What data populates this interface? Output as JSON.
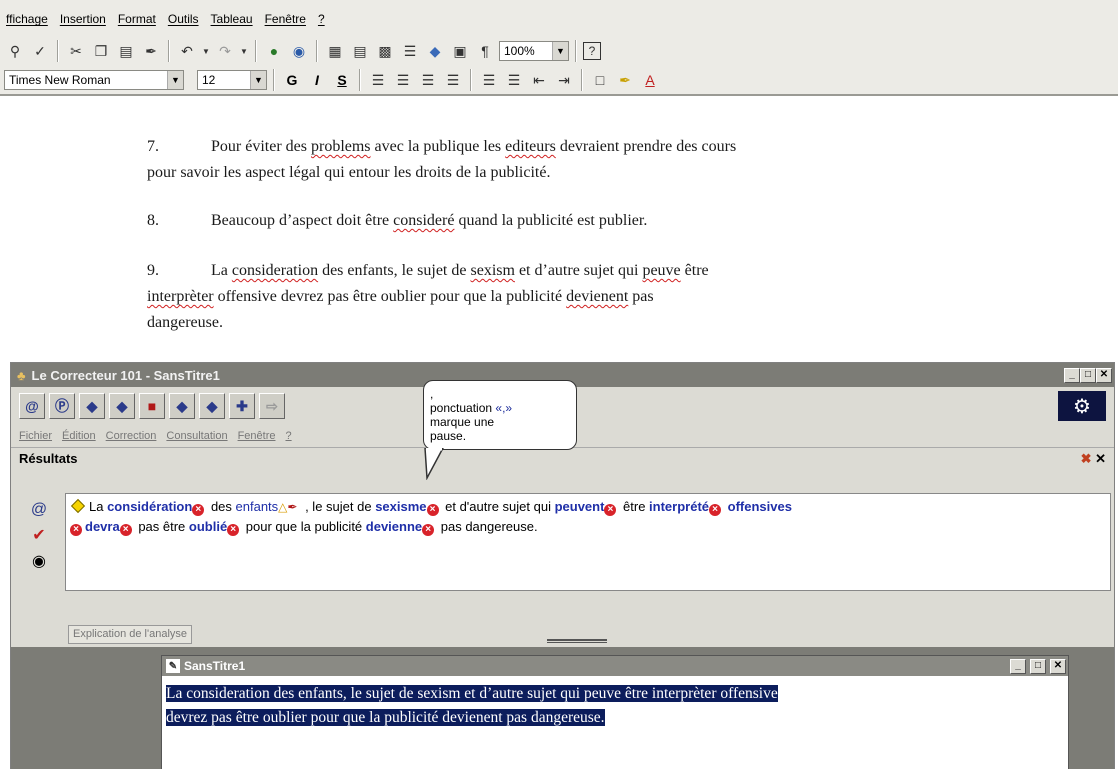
{
  "word": {
    "menus": [
      "ffichage",
      "Insertion",
      "Format",
      "Outils",
      "Tableau",
      "Fenêtre",
      "?"
    ],
    "zoom": "100%",
    "font_name": "Times New Roman",
    "font_size": "12",
    "bold_label": "G",
    "italic_label": "I",
    "underline_label": "S"
  },
  "document": {
    "p7_num": "7.",
    "p7_a": "Pour éviter des ",
    "p7_b": "problems",
    "p7_c": " avec la publique les ",
    "p7_d": "editeurs",
    "p7_e": " devraient prendre des cours",
    "p7_line2": "pour savoir les aspect légal qui entour les droits de la publicité.",
    "p8_num": "8.",
    "p8_a": "Beaucoup d’aspect doit être ",
    "p8_b": "consideré",
    "p8_c": " quand la publicité est publier.",
    "p9_num": "9.",
    "p9_a": "La ",
    "p9_b": "consideration",
    "p9_c": " des enfants, le sujet de ",
    "p9_d": "sexism",
    "p9_e": " et d’autre sujet qui ",
    "p9_f": "peuve",
    "p9_g": " être",
    "p9_h": "interprèter",
    "p9_i": " offensive devrez pas être oublier pour que la publicité ",
    "p9_j": "devienent",
    "p9_k": " pas",
    "p9_line3": "dangereuse."
  },
  "correcteur": {
    "title": "Le Correcteur 101 - SansTitre1",
    "menus": [
      "Fichier",
      "Édition",
      "Correction",
      "Consultation",
      "Fenêtre",
      "?"
    ],
    "results_label": "Résultats",
    "explication_tab": "Explication de l'analyse",
    "sentence": {
      "w1": "La ",
      "w2": "considération",
      "w3": " des ",
      "w4": "enfants",
      "w5": " , le sujet de ",
      "w6": "sexisme",
      "w7": " et d'autre sujet qui ",
      "w8": "peuvent",
      "w9": " être ",
      "w10": "interprété",
      "w11": " offensives",
      "w12": "devra",
      "w13": " pas être ",
      "w14": "oublié",
      "w15": " pour que la publicité ",
      "w16": "devienne",
      "w17": " pas dangereuse."
    },
    "callout": {
      "line1": ",",
      "line2": "ponctuation ",
      "line2b": "«,»",
      "line3": "marque une",
      "line4": "pause."
    }
  },
  "sanstitre": {
    "title": "SansTitre1",
    "line1": "La consideration des enfants, le sujet de sexism et d’autre sujet qui peuve être interprèter offensive",
    "line2": "devrez pas être oublier pour que la publicité devienent pas dangereuse."
  }
}
